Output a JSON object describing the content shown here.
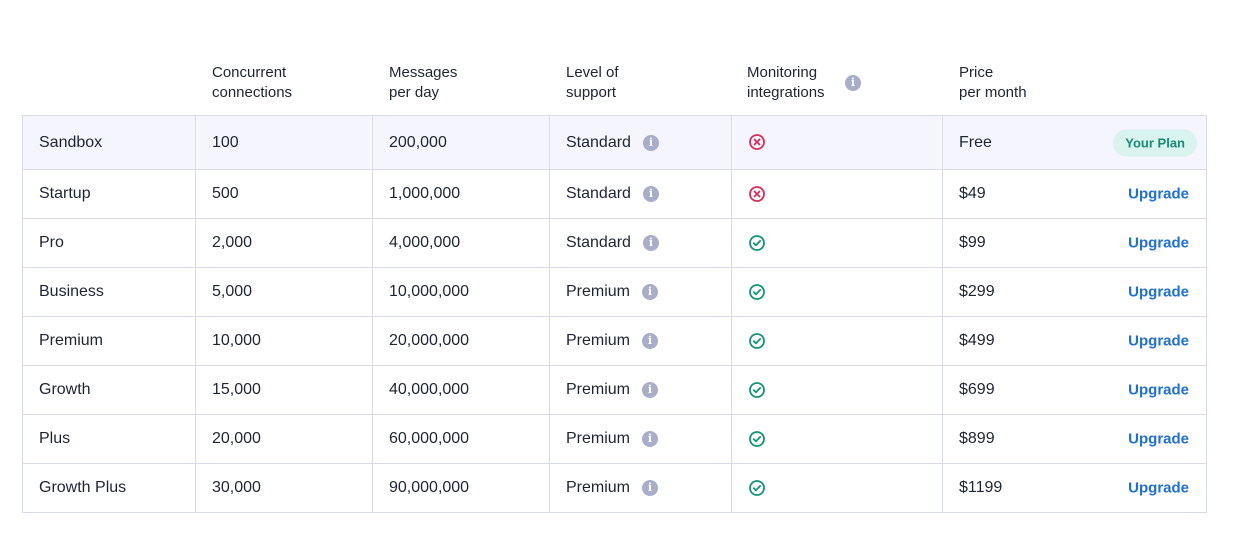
{
  "header": {
    "col_connections": [
      "Concurrent",
      "connections"
    ],
    "col_messages": [
      "Messages",
      "per day"
    ],
    "col_support": [
      "Level of",
      "support"
    ],
    "col_monitoring": [
      "Monitoring",
      "integrations"
    ],
    "col_price": [
      "Price",
      "per month"
    ]
  },
  "rows": [
    {
      "plan": "Sandbox",
      "connections": "100",
      "messages": "200,000",
      "support": "Standard",
      "monitoring": false,
      "price": "Free",
      "action": "Your Plan",
      "current": true
    },
    {
      "plan": "Startup",
      "connections": "500",
      "messages": "1,000,000",
      "support": "Standard",
      "monitoring": false,
      "price": "$49",
      "action": "Upgrade",
      "current": false
    },
    {
      "plan": "Pro",
      "connections": "2,000",
      "messages": "4,000,000",
      "support": "Standard",
      "monitoring": true,
      "price": "$99",
      "action": "Upgrade",
      "current": false
    },
    {
      "plan": "Business",
      "connections": "5,000",
      "messages": "10,000,000",
      "support": "Premium",
      "monitoring": true,
      "price": "$299",
      "action": "Upgrade",
      "current": false
    },
    {
      "plan": "Premium",
      "connections": "10,000",
      "messages": "20,000,000",
      "support": "Premium",
      "monitoring": true,
      "price": "$499",
      "action": "Upgrade",
      "current": false
    },
    {
      "plan": "Growth",
      "connections": "15,000",
      "messages": "40,000,000",
      "support": "Premium",
      "monitoring": true,
      "price": "$699",
      "action": "Upgrade",
      "current": false
    },
    {
      "plan": "Plus",
      "connections": "20,000",
      "messages": "60,000,000",
      "support": "Premium",
      "monitoring": true,
      "price": "$899",
      "action": "Upgrade",
      "current": false
    },
    {
      "plan": "Growth Plus",
      "connections": "30,000",
      "messages": "90,000,000",
      "support": "Premium",
      "monitoring": true,
      "price": "$1199",
      "action": "Upgrade",
      "current": false
    }
  ],
  "icons": {
    "info": "info-icon",
    "included": "check-circle-icon",
    "not_included": "x-circle-icon"
  },
  "colors": {
    "check": "#12957a",
    "cross": "#dd2a5b",
    "link": "#1f6fd8",
    "current_badge_bg": "#d9f3ee",
    "current_badge_text": "#1a8a72",
    "highlight_row": "#f4f5fd"
  }
}
